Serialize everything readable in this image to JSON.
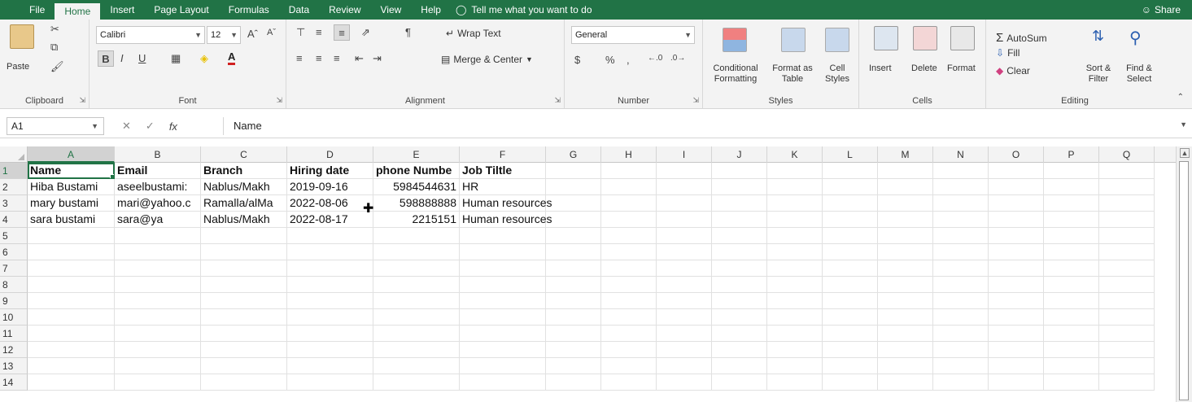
{
  "menu": {
    "tabs": [
      "File",
      "Home",
      "Insert",
      "Page Layout",
      "Formulas",
      "Data",
      "Review",
      "View",
      "Help"
    ],
    "active_tab": "Home",
    "tell_me": "Tell me what you want to do",
    "share": "Share"
  },
  "ribbon": {
    "clipboard": {
      "label": "Clipboard",
      "paste": "Paste"
    },
    "font": {
      "label": "Font",
      "name": "Calibri",
      "size": "12"
    },
    "alignment": {
      "label": "Alignment",
      "wrap_text": "Wrap Text",
      "merge_center": "Merge & Center"
    },
    "number": {
      "label": "Number",
      "format": "General"
    },
    "styles": {
      "label": "Styles",
      "conditional_1": "Conditional",
      "conditional_2": "Formatting",
      "format_as_1": "Format as",
      "format_as_2": "Table",
      "cell_styles_1": "Cell",
      "cell_styles_2": "Styles"
    },
    "cells": {
      "label": "Cells",
      "insert": "Insert",
      "delete": "Delete",
      "format": "Format"
    },
    "editing": {
      "label": "Editing",
      "autosum": "AutoSum",
      "fill": "Fill",
      "clear": "Clear",
      "sort_1": "Sort &",
      "sort_2": "Filter",
      "find_1": "Find &",
      "find_2": "Select"
    }
  },
  "formula_bar": {
    "name_box": "A1",
    "fx": "fx",
    "value": "Name"
  },
  "sheet": {
    "columns": [
      "A",
      "B",
      "C",
      "D",
      "E",
      "F",
      "G",
      "H",
      "I",
      "J",
      "K",
      "L",
      "M",
      "N",
      "O",
      "P",
      "Q"
    ],
    "row_numbers": [
      "1",
      "2",
      "3",
      "4",
      "5",
      "6",
      "7",
      "8",
      "9",
      "10",
      "11",
      "12",
      "13",
      "14"
    ],
    "header": [
      "Name",
      "Email",
      "Branch",
      "Hiring date",
      "phone Numbe",
      "Job Tiltle"
    ],
    "rows": [
      [
        "Hiba Bustami",
        "aseelbustami:",
        "Nablus/Makh",
        "2019-09-16",
        "5984544631",
        "HR"
      ],
      [
        "mary bustami",
        "mari@yahoo.c",
        "Ramalla/alMa",
        "2022-08-06",
        "598888888",
        "Human resources"
      ],
      [
        "sara bustami",
        "sara@ya",
        "Nablus/Makh",
        "2022-08-17",
        "2215151",
        "Human resources"
      ]
    ]
  },
  "colors": {
    "excel_green": "#217346"
  }
}
